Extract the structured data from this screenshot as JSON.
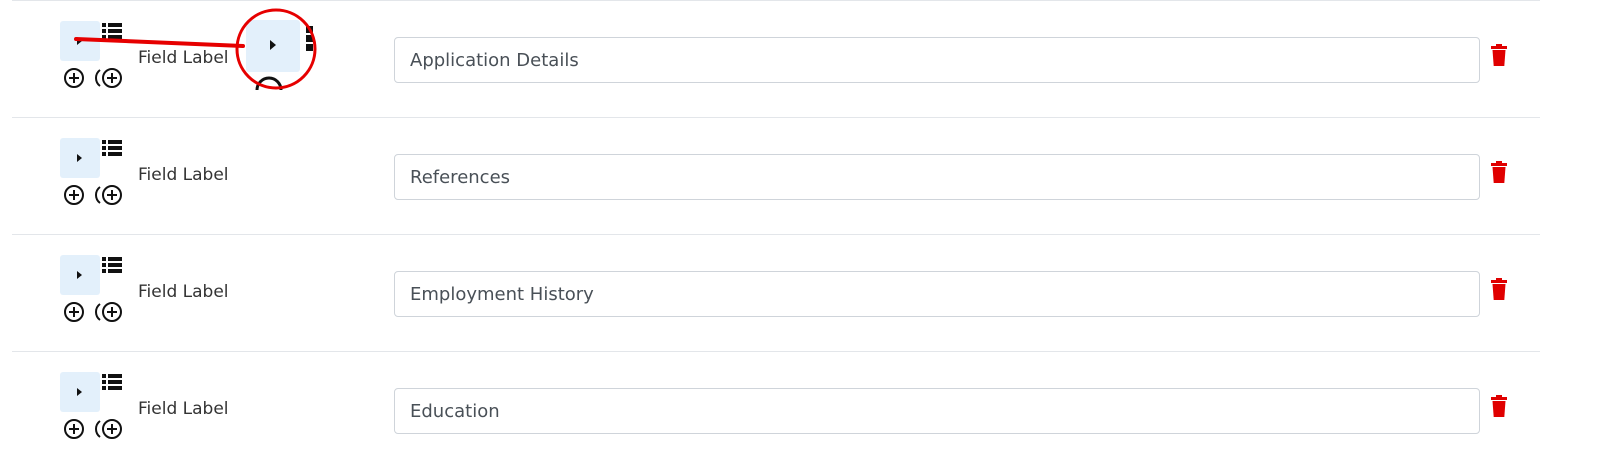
{
  "fields": [
    {
      "label": "Field Label",
      "value": "Application Details"
    },
    {
      "label": "Field Label",
      "value": "References"
    },
    {
      "label": "Field Label",
      "value": "Employment History"
    },
    {
      "label": "Field Label",
      "value": "Education"
    }
  ],
  "icons": {
    "expand": "caret-right-icon",
    "list": "list-icon",
    "add": "plus-circle-icon",
    "add_nested": "plus-circle-nested-icon",
    "delete": "trash-icon"
  },
  "colors": {
    "expand_bg": "#e3f0fb",
    "delete": "#e00000",
    "annotation": "#e60000"
  }
}
